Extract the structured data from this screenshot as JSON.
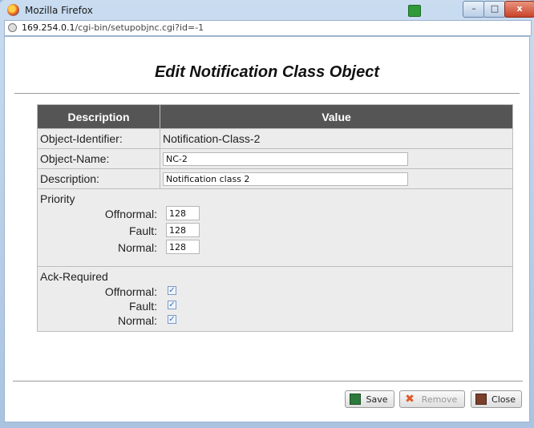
{
  "window": {
    "title": "Mozilla Firefox",
    "min": "–",
    "max": "□",
    "close": "x"
  },
  "address": {
    "host": "169.254.0.1",
    "path": "/cgi-bin/setupobjnc.cgi?id=-1"
  },
  "page": {
    "title": "Edit Notification Class Object"
  },
  "table": {
    "headers": {
      "description": "Description",
      "value": "Value"
    },
    "object_identifier": {
      "label": "Object-Identifier:",
      "value": "Notification-Class-2"
    },
    "object_name": {
      "label": "Object-Name:",
      "value": "NC-2"
    },
    "description": {
      "label": "Description:",
      "value": "Notification class 2"
    },
    "priority": {
      "title": "Priority",
      "offnormal": {
        "label": "Offnormal:",
        "value": "128"
      },
      "fault": {
        "label": "Fault:",
        "value": "128"
      },
      "normal": {
        "label": "Normal:",
        "value": "128"
      }
    },
    "ack_required": {
      "title": "Ack-Required",
      "offnormal": {
        "label": "Offnormal:",
        "checked": true
      },
      "fault": {
        "label": "Fault:",
        "checked": true
      },
      "normal": {
        "label": "Normal:",
        "checked": true
      }
    }
  },
  "buttons": {
    "save": "Save",
    "remove": "Remove",
    "close": "Close"
  },
  "icons": {
    "firefox": "firefox-icon",
    "globe": "globe-icon",
    "save": "save-icon",
    "remove": "remove-icon",
    "close": "close-icon"
  }
}
